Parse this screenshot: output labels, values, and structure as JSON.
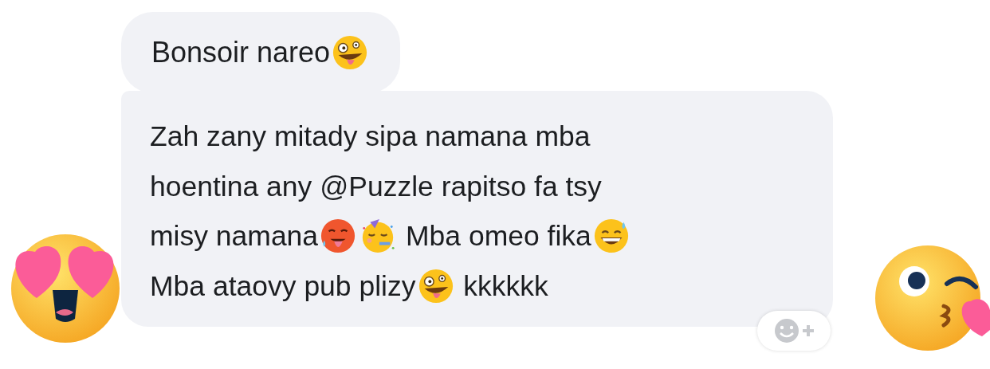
{
  "messages": [
    {
      "lines": [
        [
          {
            "kind": "text",
            "text": "Bonsoir nareo"
          },
          {
            "kind": "zany"
          }
        ]
      ]
    },
    {
      "lines": [
        [
          {
            "kind": "text",
            "text": "Zah zany mitady sipa namana mba"
          }
        ],
        [
          {
            "kind": "text",
            "text": "hoentina any @Puzzle rapitso fa tsy"
          }
        ],
        [
          {
            "kind": "text",
            "text": "misy namana"
          },
          {
            "kind": "hot"
          },
          {
            "kind": "party"
          },
          {
            "kind": "text",
            "text": " Mba omeo fika"
          },
          {
            "kind": "sweat"
          }
        ],
        [
          {
            "kind": "text",
            "text": "Mba ataovy pub plizy"
          },
          {
            "kind": "zany"
          },
          {
            "kind": "text",
            "text": " kkkkkk"
          }
        ]
      ]
    }
  ]
}
